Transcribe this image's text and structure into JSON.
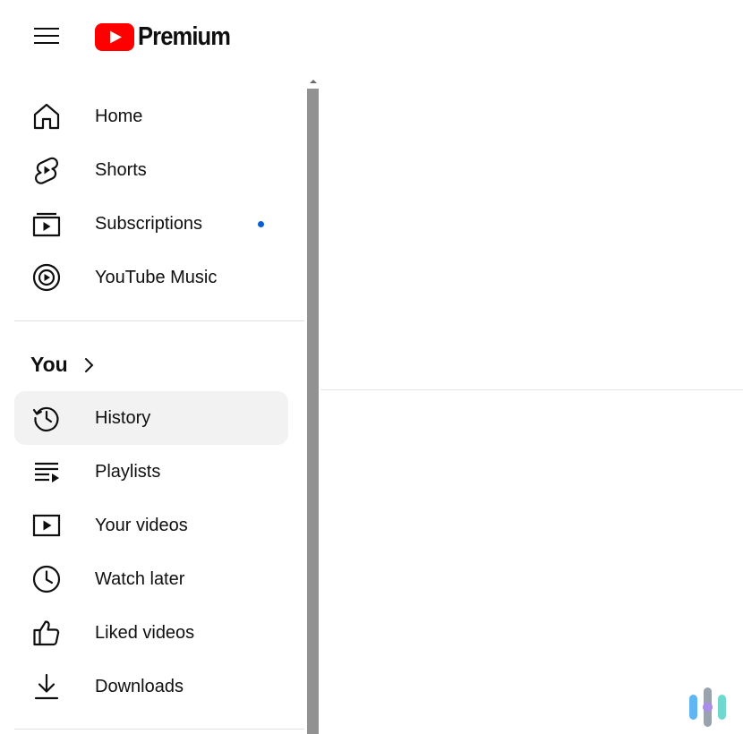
{
  "app": {
    "logo_text": "Premium",
    "brand_color": "#ff0000"
  },
  "sidebar": {
    "primary": [
      {
        "label": "Home",
        "icon": "home-icon"
      },
      {
        "label": "Shorts",
        "icon": "shorts-icon"
      },
      {
        "label": "Subscriptions",
        "icon": "subscriptions-icon",
        "has_new_indicator": true
      },
      {
        "label": "YouTube Music",
        "icon": "youtube-music-icon"
      }
    ],
    "you_section": {
      "title": "You",
      "items": [
        {
          "label": "History",
          "icon": "history-icon",
          "active": true
        },
        {
          "label": "Playlists",
          "icon": "playlists-icon"
        },
        {
          "label": "Your videos",
          "icon": "your-videos-icon"
        },
        {
          "label": "Watch later",
          "icon": "watch-later-icon"
        },
        {
          "label": "Liked videos",
          "icon": "liked-videos-icon"
        },
        {
          "label": "Downloads",
          "icon": "downloads-icon"
        }
      ]
    },
    "indicator_color": "#065fd4",
    "active_bg": "#f2f2f2"
  }
}
